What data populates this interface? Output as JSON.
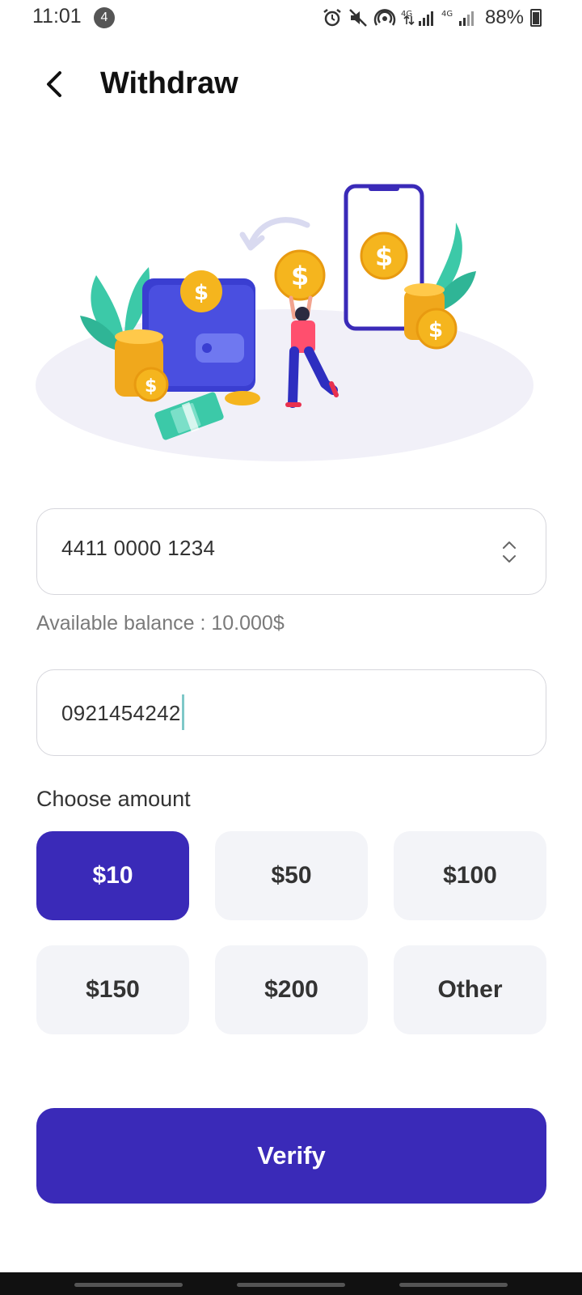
{
  "status_bar": {
    "time": "11:01",
    "notification_count": "4",
    "battery": "88%"
  },
  "header": {
    "title": "Withdraw",
    "back_icon": "chevron-left-icon"
  },
  "card_select": {
    "value": "4411 0000 1234",
    "icon": "up-down-chevron-icon"
  },
  "balance": {
    "text": "Available balance : 10.000$"
  },
  "phone_input": {
    "value": "0921454242"
  },
  "amount": {
    "label": "Choose amount",
    "options": [
      "$10",
      "$50",
      "$100",
      "$150",
      "$200",
      "Other"
    ],
    "selected": "$10"
  },
  "verify_button": {
    "label": "Verify"
  },
  "colors": {
    "accent": "#3a2ab8",
    "option_bg": "#f3f4f8",
    "coin": "#f5a623",
    "leaf": "#3cc9a8"
  }
}
